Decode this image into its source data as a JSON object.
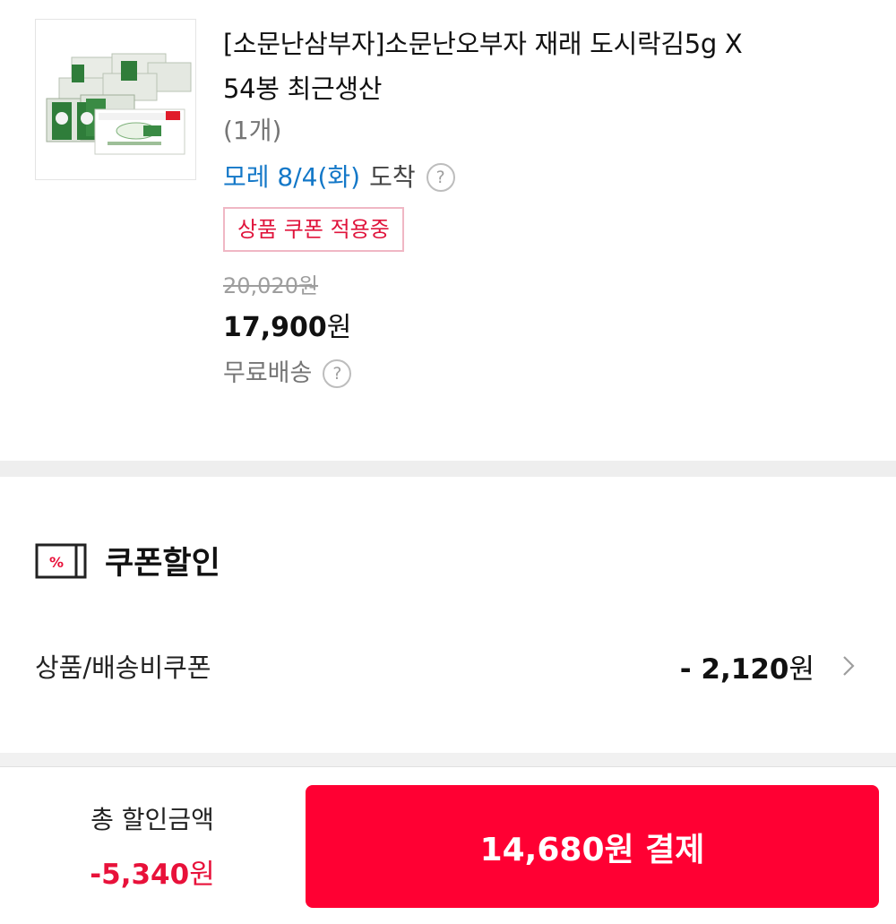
{
  "product": {
    "image_alt": "seaweed-box-product-image",
    "title_line1": "[소문난삼부자]소문난오부자 재래 도시락김5g X",
    "title_line2": "54봉 최근생산",
    "quantity": "(1개)",
    "delivery_date": "모레 8/4(화)",
    "delivery_suffix": "도착",
    "help_icon": "question-mark-circle-icon",
    "coupon_badge": "상품 쿠폰 적용중",
    "original_price": "20,020원",
    "sale_price": "17,900",
    "sale_price_unit": "원",
    "shipping": "무료배송"
  },
  "coupon_section": {
    "icon": "percent-ticket-icon",
    "title": "쿠폰할인",
    "row_label": "상품/배송비쿠폰",
    "row_amount": "- 2,120",
    "row_amount_unit": "원",
    "row_icon": "chevron-right-icon"
  },
  "footer": {
    "total_label": "총 할인금액",
    "total_amount": "-5,340",
    "total_amount_unit": "원",
    "pay_button": "14,680원 결제"
  },
  "colors": {
    "accent_red": "#ff0033",
    "discount_red": "#e8113a",
    "delivery_blue": "#1478c8",
    "badge_border": "#f0b7c4"
  }
}
